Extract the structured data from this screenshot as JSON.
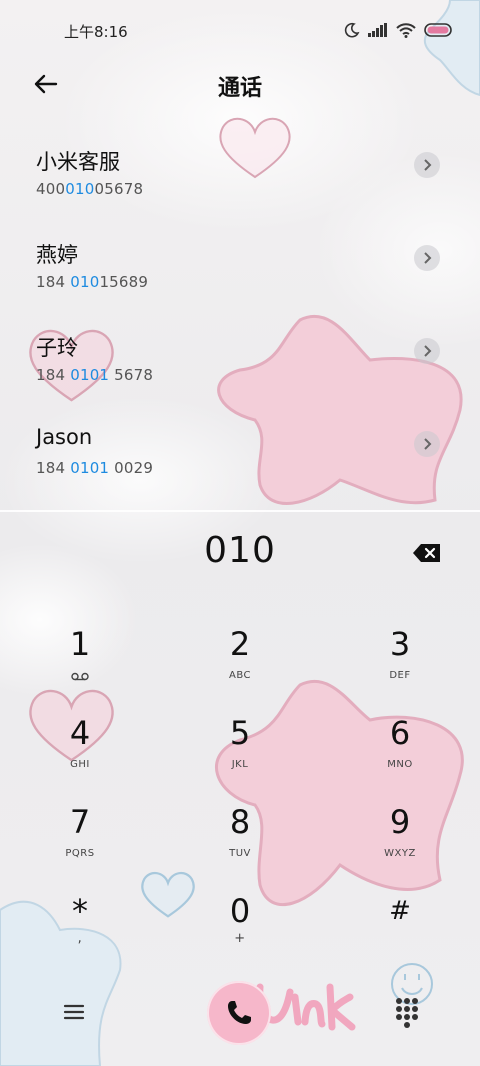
{
  "status_bar": {
    "time": "上午8:16"
  },
  "header": {
    "title": "通话"
  },
  "contacts": [
    {
      "name": "小米客服",
      "number_parts": [
        "400",
        "010",
        "05678"
      ]
    },
    {
      "name": "燕婷",
      "number_parts": [
        "184 ",
        "010",
        "15689"
      ]
    },
    {
      "name": "子玲",
      "number_parts": [
        "184 ",
        "0101",
        " 5678"
      ]
    },
    {
      "name": "Jason",
      "number_parts": [
        "184 ",
        "0101",
        " 0029"
      ]
    }
  ],
  "dialer": {
    "number": "010"
  },
  "keypad": [
    {
      "digit": "1",
      "letters": "",
      "icon": "voicemail-icon"
    },
    {
      "digit": "2",
      "letters": "ABC"
    },
    {
      "digit": "3",
      "letters": "DEF"
    },
    {
      "digit": "4",
      "letters": "GHI"
    },
    {
      "digit": "5",
      "letters": "JKL"
    },
    {
      "digit": "6",
      "letters": "MNO"
    },
    {
      "digit": "7",
      "letters": "PQRS"
    },
    {
      "digit": "8",
      "letters": "TUV"
    },
    {
      "digit": "9",
      "letters": "WXYZ"
    },
    {
      "digit": "*",
      "letters": ","
    },
    {
      "digit": "0",
      "letters": "+"
    },
    {
      "digit": "#",
      "letters": ""
    }
  ],
  "colors": {
    "highlight": "#1e8be0",
    "call_button": "#f6b7ca",
    "battery": "#e37aa0"
  }
}
